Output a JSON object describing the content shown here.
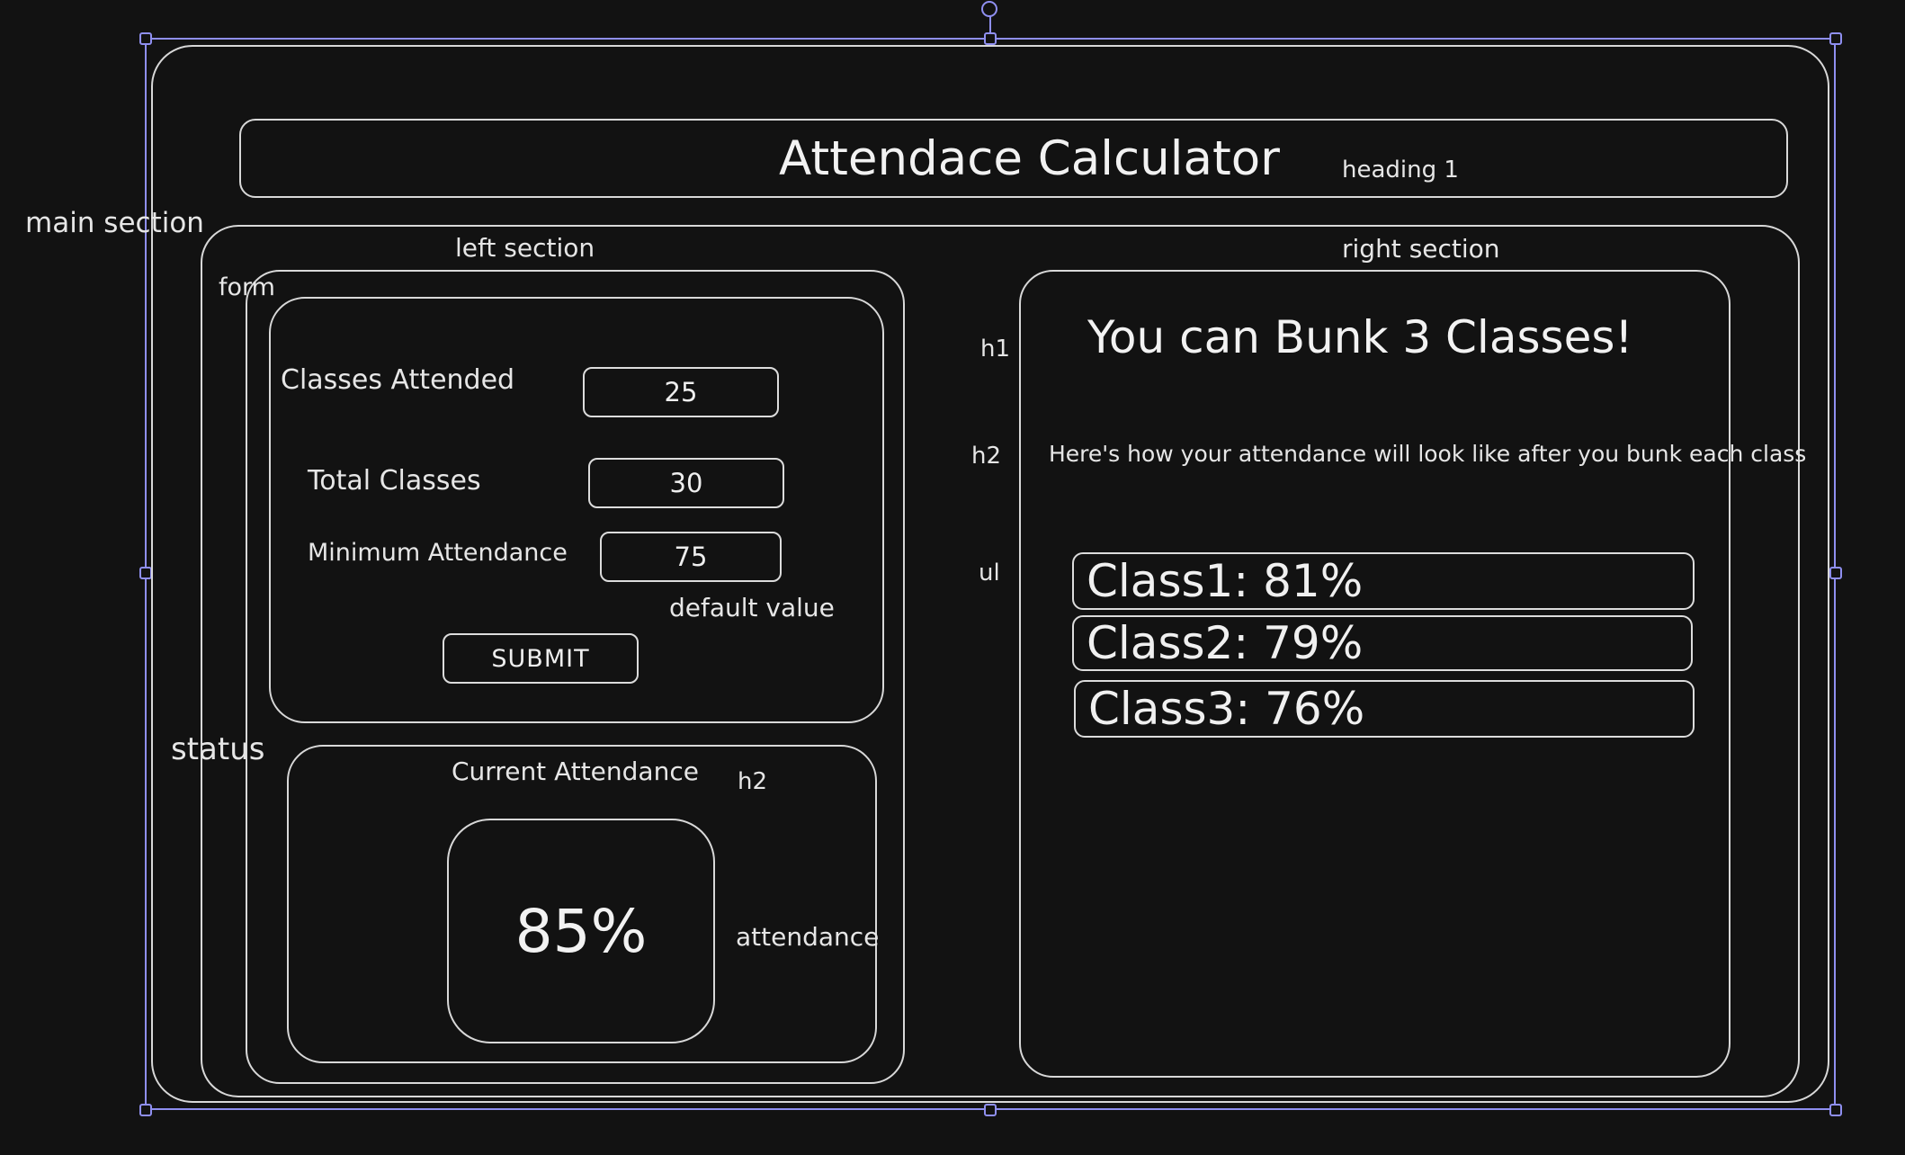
{
  "annotations": {
    "main_section": "main section",
    "heading_tag": "heading 1",
    "left_section": "left section",
    "right_section": "right section",
    "form": "form",
    "status": "status",
    "h1": "h1",
    "h2_right": "h2",
    "ul": "ul",
    "h2_status": "h2",
    "default_value": "default value",
    "attendance": "attendance"
  },
  "header": {
    "title": "Attendace Calculator"
  },
  "form": {
    "fields": [
      {
        "label": "Classes Attended",
        "value": "25"
      },
      {
        "label": "Total Classes",
        "value": "30"
      },
      {
        "label": "Minimum Attendance",
        "value": "75"
      }
    ],
    "submit_label": "SUBMIT"
  },
  "status": {
    "title": "Current Attendance",
    "value": "85%"
  },
  "result": {
    "headline": "You can Bunk 3 Classes!",
    "subtitle": "Here's how your attendance will look like after you bunk each class",
    "items": [
      {
        "text": "Class1: 81%"
      },
      {
        "text": "Class2: 79%"
      },
      {
        "text": "Class3: 76%"
      }
    ]
  },
  "colors": {
    "background": "#121212",
    "stroke": "#d8d8d8",
    "selection": "#8f8ff0"
  }
}
